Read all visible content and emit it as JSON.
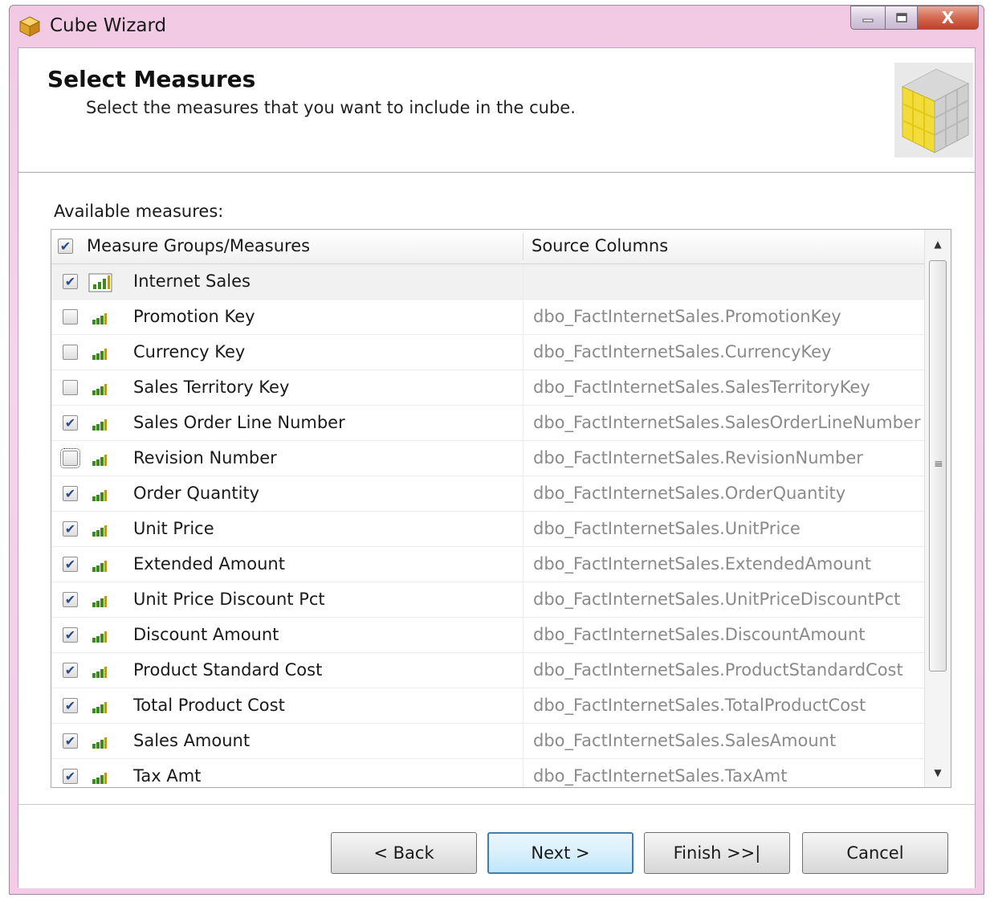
{
  "window": {
    "title": "Cube Wizard",
    "close_glyph": "X"
  },
  "header": {
    "title": "Select Measures",
    "subtitle": "Select the measures that you want to include in the cube."
  },
  "available_label": "Available measures:",
  "grid": {
    "columns": [
      "Measure Groups/Measures",
      "Source Columns"
    ],
    "header_checked": true,
    "rows": [
      {
        "name": "Internet Sales",
        "source": "",
        "checked": true,
        "group": true
      },
      {
        "name": "Promotion Key",
        "source": "dbo_FactInternetSales.PromotionKey",
        "checked": false
      },
      {
        "name": "Currency Key",
        "source": "dbo_FactInternetSales.CurrencyKey",
        "checked": false
      },
      {
        "name": "Sales Territory Key",
        "source": "dbo_FactInternetSales.SalesTerritoryKey",
        "checked": false
      },
      {
        "name": "Sales Order Line Number",
        "source": "dbo_FactInternetSales.SalesOrderLineNumber",
        "checked": true
      },
      {
        "name": "Revision Number",
        "source": "dbo_FactInternetSales.RevisionNumber",
        "checked": false,
        "focused": true
      },
      {
        "name": "Order Quantity",
        "source": "dbo_FactInternetSales.OrderQuantity",
        "checked": true
      },
      {
        "name": "Unit Price",
        "source": "dbo_FactInternetSales.UnitPrice",
        "checked": true
      },
      {
        "name": "Extended Amount",
        "source": "dbo_FactInternetSales.ExtendedAmount",
        "checked": true
      },
      {
        "name": "Unit Price Discount Pct",
        "source": "dbo_FactInternetSales.UnitPriceDiscountPct",
        "checked": true
      },
      {
        "name": "Discount Amount",
        "source": "dbo_FactInternetSales.DiscountAmount",
        "checked": true
      },
      {
        "name": "Product Standard Cost",
        "source": "dbo_FactInternetSales.ProductStandardCost",
        "checked": true
      },
      {
        "name": "Total Product Cost",
        "source": "dbo_FactInternetSales.TotalProductCost",
        "checked": true
      },
      {
        "name": "Sales Amount",
        "source": "dbo_FactInternetSales.SalesAmount",
        "checked": true
      },
      {
        "name": "Tax Amt",
        "source": "dbo_FactInternetSales.TaxAmt",
        "checked": true
      }
    ]
  },
  "buttons": {
    "back": "< Back",
    "next": "Next >",
    "finish": "Finish >>|",
    "cancel": "Cancel"
  },
  "colors": {
    "title_bar": "#f3cbe6",
    "default_button_border": "#3c7fb1",
    "measure_icon_green": "#3f8a1e",
    "cube_yellow": "#f2dc3a"
  }
}
